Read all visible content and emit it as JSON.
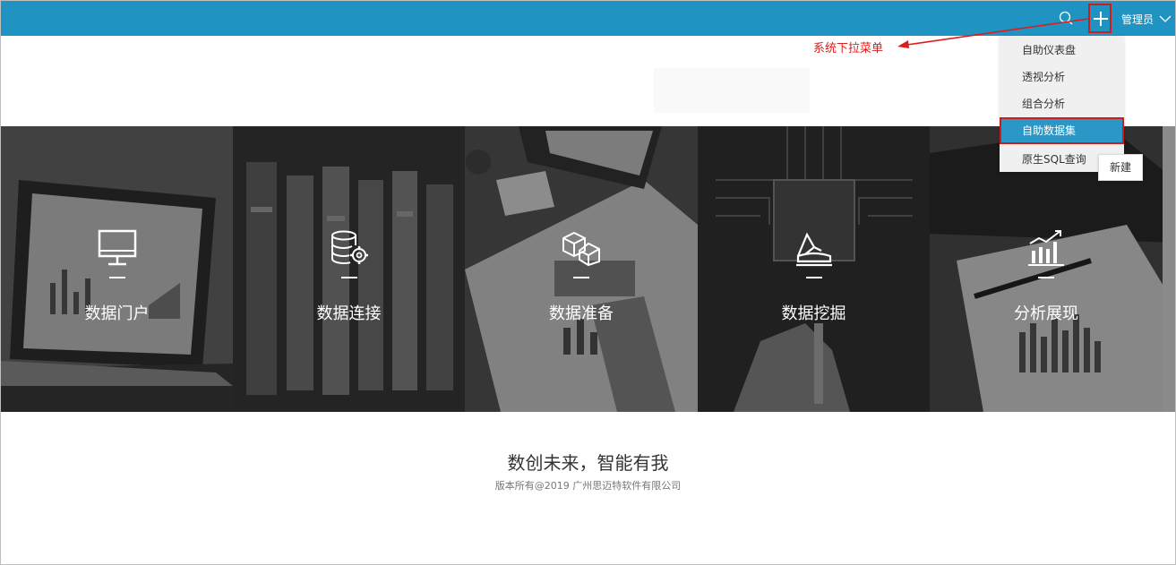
{
  "header": {
    "user_label": "管理员"
  },
  "annotation": {
    "label": "系统下拉菜单"
  },
  "dropdown": {
    "items": [
      "自助仪表盘",
      "透视分析",
      "组合分析",
      "自助数据集",
      "原生SQL查询"
    ],
    "tooltip": "新建"
  },
  "tiles": [
    {
      "label": "数据门户",
      "icon": "monitor-icon"
    },
    {
      "label": "数据连接",
      "icon": "database-gear-icon"
    },
    {
      "label": "数据准备",
      "icon": "cubes-icon"
    },
    {
      "label": "数据挖掘",
      "icon": "mining-icon"
    },
    {
      "label": "分析展现",
      "icon": "bar-chart-icon"
    }
  ],
  "footer": {
    "slogan": "数创未来，智能有我",
    "copyright": "版本所有@2019 广州思迈特软件有限公司"
  },
  "colors": {
    "topbar": "#1f93c1",
    "highlight": "#d11a1a",
    "dropdown_active": "#2b97c6",
    "annotation": "#e01b1b"
  }
}
